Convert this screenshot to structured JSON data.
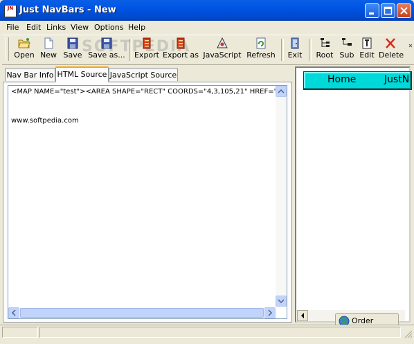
{
  "window": {
    "title": "Just NavBars - New",
    "app_icon_text": "JN",
    "controls": {
      "minimize": "_",
      "maximize": "□",
      "close": "✕"
    }
  },
  "menu": [
    "File",
    "Edit",
    "Links",
    "View",
    "Options",
    "Help"
  ],
  "toolbar": {
    "open": "Open",
    "new": "New",
    "save": "Save",
    "save_as": "Save as...",
    "export": "Export",
    "export_as": "Export as",
    "javascript": "JavaScript",
    "refresh": "Refresh",
    "exit": "Exit",
    "root": "Root",
    "sub": "Sub",
    "edit": "Edit",
    "delete": "Delete"
  },
  "tabs": [
    "Nav Bar Info",
    "HTML Source",
    "JavaScript Source"
  ],
  "active_tab": "HTML Source",
  "source": {
    "line1": "<MAP NAME=\"test\"><AREA SHAPE=\"RECT\"  COORDS=\"4,3,105,21\" HREF=\"ind",
    "line2": "www.softpedia.com"
  },
  "preview": {
    "items": [
      "Home",
      "JustN"
    ]
  },
  "order_button": "Order Online!",
  "watermark": "SOFTPEDIA",
  "colors": {
    "title_bar": "#0054e3",
    "nav_bar": "#00d9d9",
    "active_tab_accent": "#f5a70c"
  }
}
